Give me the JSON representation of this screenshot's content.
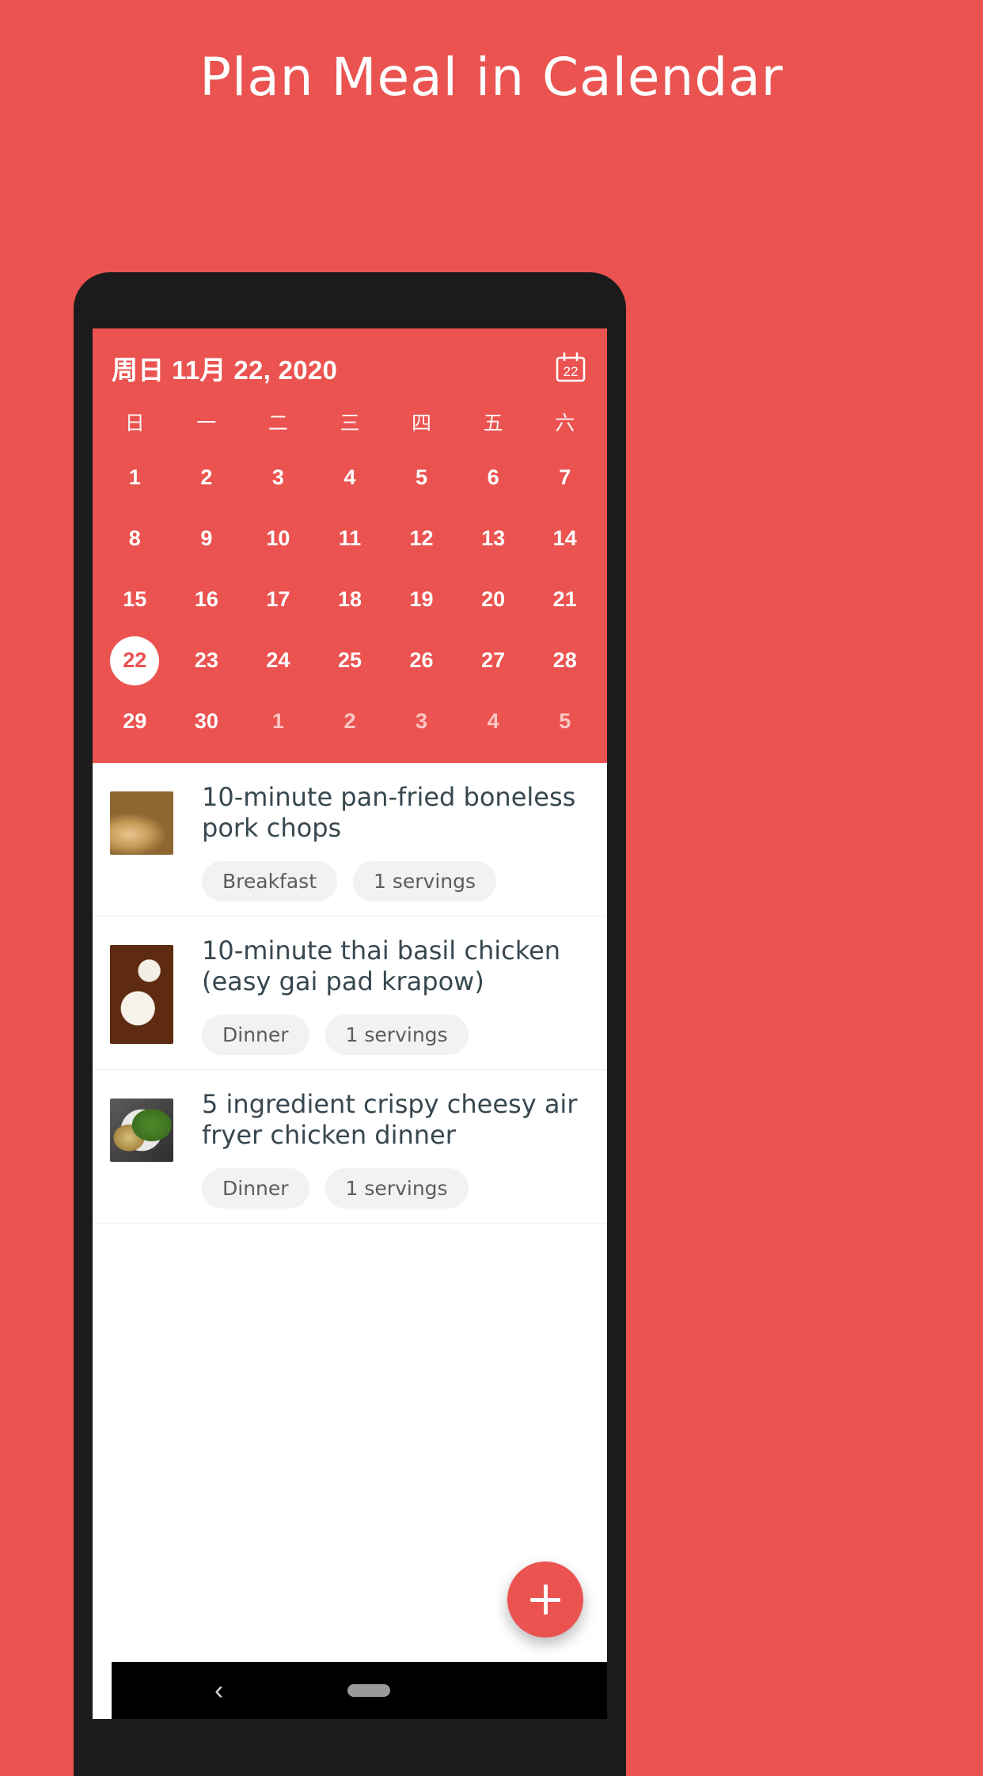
{
  "promo": {
    "title": "Plan Meal in Calendar",
    "background_color": "#eb5350"
  },
  "app": {
    "accent_color": "#eb5350",
    "calendar": {
      "header_date": "周日 11月 22, 2020",
      "icon_name": "calendar-icon",
      "icon_day": "22",
      "weekdays": [
        "日",
        "一",
        "二",
        "三",
        "四",
        "五",
        "六"
      ],
      "weeks": [
        [
          {
            "day": "1",
            "muted": false,
            "selected": false
          },
          {
            "day": "2",
            "muted": false,
            "selected": false
          },
          {
            "day": "3",
            "muted": false,
            "selected": false
          },
          {
            "day": "4",
            "muted": false,
            "selected": false
          },
          {
            "day": "5",
            "muted": false,
            "selected": false
          },
          {
            "day": "6",
            "muted": false,
            "selected": false
          },
          {
            "day": "7",
            "muted": false,
            "selected": false
          }
        ],
        [
          {
            "day": "8",
            "muted": false,
            "selected": false
          },
          {
            "day": "9",
            "muted": false,
            "selected": false
          },
          {
            "day": "10",
            "muted": false,
            "selected": false
          },
          {
            "day": "11",
            "muted": false,
            "selected": false
          },
          {
            "day": "12",
            "muted": false,
            "selected": false
          },
          {
            "day": "13",
            "muted": false,
            "selected": false
          },
          {
            "day": "14",
            "muted": false,
            "selected": false
          }
        ],
        [
          {
            "day": "15",
            "muted": false,
            "selected": false
          },
          {
            "day": "16",
            "muted": false,
            "selected": false
          },
          {
            "day": "17",
            "muted": false,
            "selected": false
          },
          {
            "day": "18",
            "muted": false,
            "selected": false
          },
          {
            "day": "19",
            "muted": false,
            "selected": false
          },
          {
            "day": "20",
            "muted": false,
            "selected": false
          },
          {
            "day": "21",
            "muted": false,
            "selected": false
          }
        ],
        [
          {
            "day": "22",
            "muted": false,
            "selected": true
          },
          {
            "day": "23",
            "muted": false,
            "selected": false
          },
          {
            "day": "24",
            "muted": false,
            "selected": false
          },
          {
            "day": "25",
            "muted": false,
            "selected": false
          },
          {
            "day": "26",
            "muted": false,
            "selected": false
          },
          {
            "day": "27",
            "muted": false,
            "selected": false
          },
          {
            "day": "28",
            "muted": false,
            "selected": false
          }
        ],
        [
          {
            "day": "29",
            "muted": false,
            "selected": false
          },
          {
            "day": "30",
            "muted": false,
            "selected": false
          },
          {
            "day": "1",
            "muted": true,
            "selected": false
          },
          {
            "day": "2",
            "muted": true,
            "selected": false
          },
          {
            "day": "3",
            "muted": true,
            "selected": false
          },
          {
            "day": "4",
            "muted": true,
            "selected": false
          },
          {
            "day": "5",
            "muted": true,
            "selected": false
          }
        ]
      ]
    },
    "recipes": [
      {
        "title": "10-minute pan-fried boneless pork chops",
        "meal_tag": "Breakfast",
        "servings_tag": "1 servings",
        "thumb_class": "thumb-porkchops",
        "thumb_tall": false
      },
      {
        "title": "10-minute thai basil chicken (easy gai pad krapow)",
        "meal_tag": "Dinner",
        "servings_tag": "1 servings",
        "thumb_class": "thumb-thaibasil",
        "thumb_tall": true
      },
      {
        "title": "5 ingredient crispy cheesy air fryer chicken dinner",
        "meal_tag": "Dinner",
        "servings_tag": "1 servings",
        "thumb_class": "thumb-airfryer",
        "thumb_tall": false
      }
    ],
    "fab": {
      "label": "+",
      "icon_name": "plus-icon"
    },
    "nav_bar": {
      "back_icon": "‹",
      "home_icon_name": "home-pill-indicator"
    }
  }
}
